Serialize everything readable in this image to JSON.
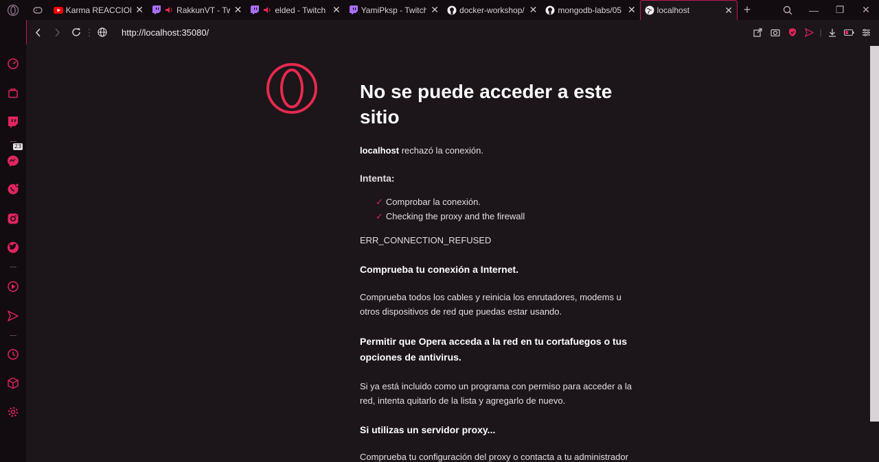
{
  "tabs": [
    {
      "title": "Karma REACCIONA",
      "favicon": "youtube-icon"
    },
    {
      "title": "RakkunVT - Tw",
      "favicon": "twitch-icon",
      "audio": true
    },
    {
      "title": "elded - Twitch",
      "favicon": "twitch-icon",
      "audio": true
    },
    {
      "title": "YamiPksp - Twitch",
      "favicon": "twitch-icon"
    },
    {
      "title": "docker-workshop/",
      "favicon": "github-icon"
    },
    {
      "title": "mongodb-labs/05",
      "favicon": "github-icon"
    },
    {
      "title": "localhost",
      "favicon": "globe-icon",
      "active": true
    }
  ],
  "address": {
    "url": "http://localhost:35080/"
  },
  "sidebar": {
    "twitch_badge": "23"
  },
  "error": {
    "title": "No se puede acceder a este sitio",
    "host": "localhost",
    "host_suffix": " rechazó la conexión.",
    "try_label": "Intenta:",
    "suggestions": [
      "Comprobar la conexión.",
      "Checking the proxy and the firewall"
    ],
    "code": "ERR_CONNECTION_REFUSED",
    "sections": [
      {
        "heading": "Comprueba tu conexión a Internet.",
        "body": "Comprueba todos los cables y reinicia los enrutadores, modems u otros dispositivos de red que puedas estar usando."
      },
      {
        "heading": "Permitir que Opera acceda a la red en tu cortafuegos o tus opciones de antivirus.",
        "body": "Si ya está incluido como un programa con permiso para acceder a la red, intenta quitarlo de la lista y agregarlo de nuevo."
      },
      {
        "heading": "Si utilizas un servidor proxy...",
        "body": "Comprueba tu configuración del proxy o contacta a tu administrador de red"
      }
    ]
  },
  "colors": {
    "accent": "#e0245e",
    "opera_red": "#e8294f",
    "background": "#1c151a"
  }
}
